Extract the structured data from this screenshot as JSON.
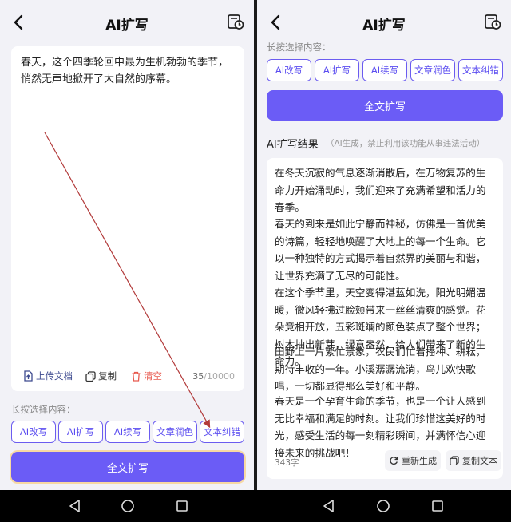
{
  "left": {
    "title": "AI扩写",
    "input_text": "春天，这个四季轮回中最为生机勃勃的季节，悄然无声地掀开了大自然的序幕。",
    "tools": {
      "upload": "上传文档",
      "copy": "复制",
      "clear": "清空"
    },
    "counter": {
      "current": "35",
      "max": "/10000"
    },
    "section_label": "长按选择内容：",
    "chips": [
      "AI改写",
      "AI扩写",
      "AI续写",
      "文章润色",
      "文本纠错"
    ],
    "primary_button": "全文扩写"
  },
  "right": {
    "title": "AI扩写",
    "section_label": "长按选择内容：",
    "chips": [
      "AI改写",
      "AI扩写",
      "AI续写",
      "文章润色",
      "文本纠错"
    ],
    "primary_button": "全文扩写",
    "result_title": "AI扩写结果",
    "result_note": "（AI生成，禁止利用该功能从事违法活动）",
    "paragraphs": [
      "在冬天沉寂的气息逐渐消散后，在万物复苏的生命力开始涌动时，我们迎来了充满希望和活力的春季。",
      "春天的到来是如此宁静而神秘，仿佛是一首优美的诗篇，轻轻地唤醒了大地上的每一个生命。它以一种独特的方式揭示着自然界的美丽与和谐，让世界充满了无尽的可能性。",
      "在这个季节里，天空变得湛蓝如洗，阳光明媚温暖，微风轻拂过脸颊带来一丝丝清爽的感觉。花朵竞相开放，五彩斑斓的颜色装点了整个世界；树木抽出新芽，绿意盎然，给人们带来了新的生命力。",
      "田野上一片繁忙景象，农民们忙着播种、耕耘，期待丰收的一年。小溪潺潺流淌，鸟儿欢快歌唱，一切都显得那么美好和平静。",
      "春天是一个孕育生命的季节，也是一个让人感到无比幸福和满足的时刻。让我们珍惜这美好的时光，感受生活的每一刻精彩瞬间，并满怀信心迎接未来的挑战吧！"
    ],
    "word_count": "343字",
    "regenerate": "重新生成",
    "copy_text": "复制文本"
  },
  "colors": {
    "accent": "#6b5cf6",
    "danger": "#e85a4f",
    "annotation": "#b23a3a"
  },
  "icons": [
    "back-icon",
    "history-icon",
    "upload-icon",
    "copy-icon",
    "trash-icon",
    "refresh-icon",
    "nav-back-icon",
    "nav-home-icon",
    "nav-recents-icon"
  ]
}
